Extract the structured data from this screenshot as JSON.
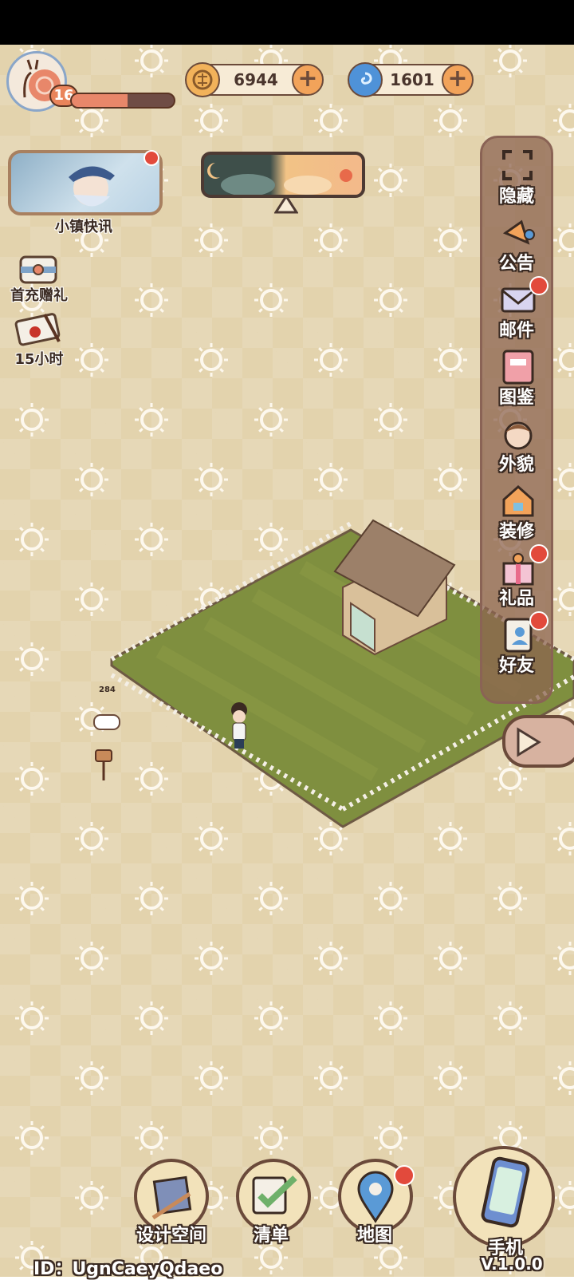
{
  "player": {
    "level": "16",
    "xp_fraction": 0.55
  },
  "currencies": [
    {
      "name": "coin",
      "value": "6944"
    },
    {
      "name": "gem",
      "value": "1601"
    }
  ],
  "left_panel": {
    "news_label": "小镇快讯",
    "first_charge_label": "首充赠礼",
    "letter_timer": "15小时"
  },
  "right_menu": [
    {
      "key": "hide",
      "label": "隐藏",
      "icon": "expand-frame-icon",
      "dot": false
    },
    {
      "key": "notice",
      "label": "公告",
      "icon": "megaphone-icon",
      "dot": false
    },
    {
      "key": "mail",
      "label": "邮件",
      "icon": "envelope-icon",
      "dot": true
    },
    {
      "key": "collection",
      "label": "图鉴",
      "icon": "book-icon",
      "dot": false
    },
    {
      "key": "appearance",
      "label": "外貌",
      "icon": "face-icon",
      "dot": false
    },
    {
      "key": "decorate",
      "label": "装修",
      "icon": "house-wrench-icon",
      "dot": false
    },
    {
      "key": "gift",
      "label": "礼品",
      "icon": "gift-box-icon",
      "dot": true
    },
    {
      "key": "friends",
      "label": "好友",
      "icon": "contact-book-icon",
      "dot": true
    }
  ],
  "world": {
    "mailbox_count": "284"
  },
  "bottom_nav": {
    "design": "设计空间",
    "list": "清单",
    "map": "地图",
    "phone": "手机"
  },
  "footer": {
    "id_text": "ID：UgnCaeyQdaeo",
    "version": "V.1.0.0"
  },
  "colors": {
    "accent": "#f2a35a",
    "outline": "#3a2a22",
    "grass": "#7f8f3f",
    "alert": "#e24a3c"
  }
}
